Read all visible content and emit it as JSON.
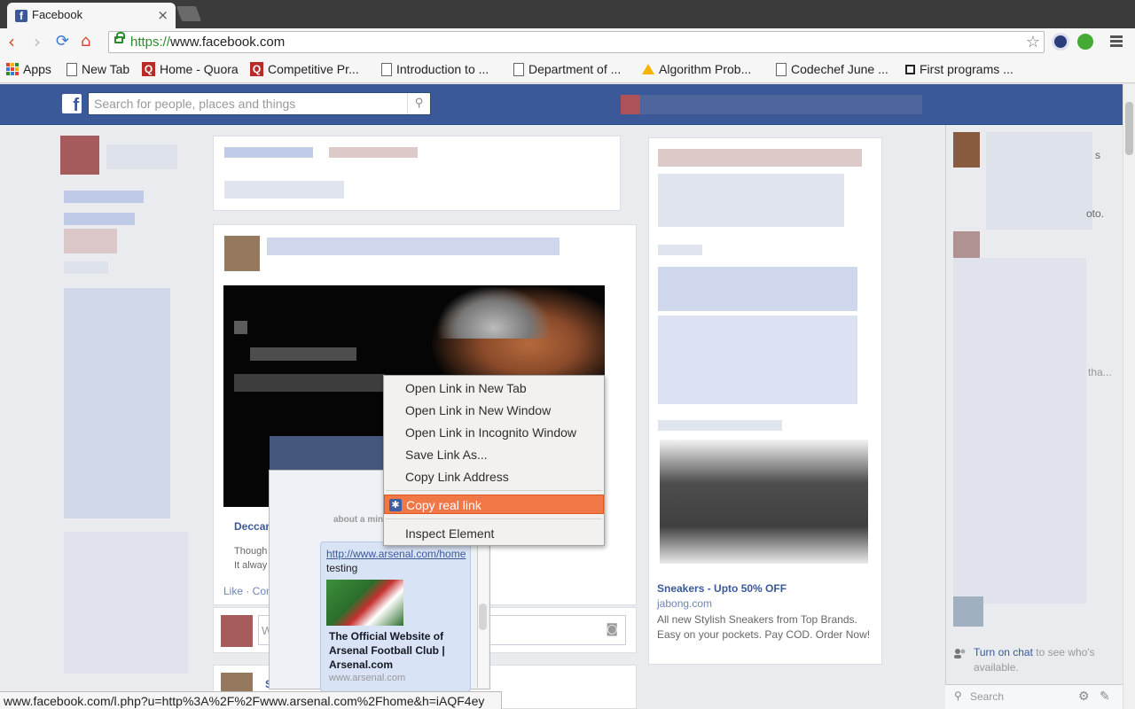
{
  "browser": {
    "tab": {
      "title": "Facebook",
      "favicon": "facebook-icon",
      "close": "×"
    },
    "url": {
      "scheme": "https://",
      "host": "www.facebook.com"
    },
    "bookmarks": [
      {
        "label": "Apps",
        "icon": "apps-grid-icon"
      },
      {
        "label": "New Tab",
        "icon": "page-icon"
      },
      {
        "label": "Home - Quora",
        "icon": "quora-icon"
      },
      {
        "label": "Competitive Pr...",
        "icon": "quora-icon"
      },
      {
        "label": "Introduction to ...",
        "icon": "page-icon"
      },
      {
        "label": "Department of ...",
        "icon": "page-icon"
      },
      {
        "label": "Algorithm Prob...",
        "icon": "drive-icon"
      },
      {
        "label": "Codechef June ...",
        "icon": "page-icon"
      },
      {
        "label": "First programs ...",
        "icon": "box-icon"
      }
    ],
    "status_url": "www.facebook.com/l.php?u=http%3A%2F%2Fwww.arsenal.com%2Fhome&h=iAQF4ey"
  },
  "facebook": {
    "logo": "f",
    "search_placeholder": "Search for people, places and things",
    "post": {
      "author_partial": "Deccan",
      "text_line1": "Though",
      "text_line2": "It alway",
      "actions": "Like · Com"
    },
    "comment_box_partial": "W",
    "bottom_partial": "S"
  },
  "context_menu": {
    "items": [
      "Open Link in New Tab",
      "Open Link in New Window",
      "Open Link in Incognito Window",
      "Save Link As...",
      "Copy Link Address",
      "Copy real link",
      "Inspect Element"
    ],
    "highlighted": "Copy real link"
  },
  "chat_popup": {
    "time": "about a min",
    "link": "http://www.arsenal.com/home",
    "message": "testing",
    "preview_title": "The Official Website of Arsenal Football Club | Arsenal.com",
    "preview_site": "www.arsenal.com"
  },
  "ad": {
    "title": "Sneakers - Upto 50% OFF",
    "domain": "jabong.com",
    "text": "All new Stylish Sneakers from Top Brands. Easy on your pockets. Pay COD. Order Now!"
  },
  "chat_sidebar": {
    "partials": [
      "s",
      "oto.",
      "tha..."
    ],
    "turn_on_link": "Turn on chat",
    "turn_on_rest": " to see who's available.",
    "search_placeholder": "Search"
  },
  "colors": {
    "facebook_blue": "#3b5998",
    "menu_highlight": "#f07746",
    "https_green": "#2a8d2a"
  }
}
